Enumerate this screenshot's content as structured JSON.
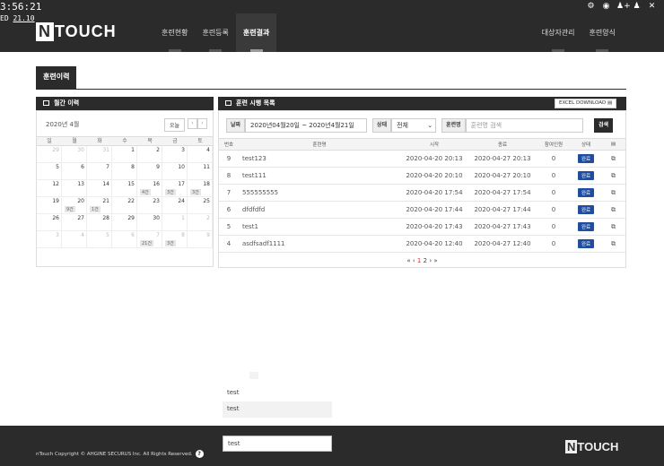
{
  "top": {
    "clock": "3:56:21",
    "clock_sub_a": "ED",
    "clock_sub_b": "21.10",
    "icons": [
      "gear-icon",
      "eye-icon",
      "user-add-icon",
      "user-icon",
      "close-icon"
    ]
  },
  "header": {
    "logo_n": "N",
    "logo_text": "TOUCH",
    "nav": [
      "훈련현황",
      "훈련등록",
      "훈련결과"
    ],
    "nav_active": 2,
    "nav_right": [
      "대상자관리",
      "훈련양식"
    ]
  },
  "page_tab": "훈련이력",
  "calendar": {
    "title": "월간 이력",
    "month": "2020년 4월",
    "today_label": "오늘",
    "prev": "‹",
    "next": "›",
    "dow": [
      "일",
      "월",
      "화",
      "수",
      "목",
      "금",
      "토"
    ],
    "cells": [
      {
        "d": "29",
        "dim": true
      },
      {
        "d": "30",
        "dim": true
      },
      {
        "d": "31",
        "dim": true
      },
      {
        "d": "1"
      },
      {
        "d": "2"
      },
      {
        "d": "3"
      },
      {
        "d": "4"
      },
      {
        "d": "5"
      },
      {
        "d": "6"
      },
      {
        "d": "7"
      },
      {
        "d": "8"
      },
      {
        "d": "9"
      },
      {
        "d": "10"
      },
      {
        "d": "11"
      },
      {
        "d": "12"
      },
      {
        "d": "13"
      },
      {
        "d": "14"
      },
      {
        "d": "15"
      },
      {
        "d": "16",
        "badge": "4건"
      },
      {
        "d": "17",
        "badge": "3건"
      },
      {
        "d": "18",
        "badge": "3건"
      },
      {
        "d": "19"
      },
      {
        "d": "20",
        "badge": "9건"
      },
      {
        "d": "21",
        "badge": "1건"
      },
      {
        "d": "22"
      },
      {
        "d": "23"
      },
      {
        "d": "24"
      },
      {
        "d": "25"
      },
      {
        "d": "26"
      },
      {
        "d": "27"
      },
      {
        "d": "28"
      },
      {
        "d": "29"
      },
      {
        "d": "30"
      },
      {
        "d": "1",
        "dim": true
      },
      {
        "d": "2",
        "dim": true
      },
      {
        "d": "3",
        "dim": true
      },
      {
        "d": "4",
        "dim": true
      },
      {
        "d": "5",
        "dim": true
      },
      {
        "d": "6",
        "dim": true
      },
      {
        "d": "7",
        "dim": true,
        "badge": "21건"
      },
      {
        "d": "8",
        "dim": true,
        "badge": "3건"
      },
      {
        "d": "9",
        "dim": true
      }
    ]
  },
  "history": {
    "title": "훈련 시행 목록",
    "excel_label": "EXCEL DOWNLOAD",
    "filter": {
      "date_label": "날짜",
      "date_range": "2020년04월20일  ~  2020년4월21일",
      "status_label": "상태",
      "status_value": "전체",
      "name_label": "훈련명",
      "name_placeholder": "훈련명 검색",
      "search_label": "검색"
    },
    "columns": [
      "번호",
      "훈련명",
      "시작",
      "종료",
      "참여인원",
      "상태",
      ""
    ],
    "rows": [
      {
        "no": "9",
        "name": "test123",
        "start": "2020-04-20 20:13",
        "end": "2020-04-27 20:13",
        "count": "0",
        "status": "완료"
      },
      {
        "no": "8",
        "name": "test111",
        "start": "2020-04-20 20:10",
        "end": "2020-04-27 20:10",
        "count": "0",
        "status": "완료"
      },
      {
        "no": "7",
        "name": "555555555",
        "start": "2020-04-20 17:54",
        "end": "2020-04-27 17:54",
        "count": "0",
        "status": "완료"
      },
      {
        "no": "6",
        "name": "dfdfdfd",
        "start": "2020-04-20 17:44",
        "end": "2020-04-27 17:44",
        "count": "0",
        "status": "완료"
      },
      {
        "no": "5",
        "name": "test1",
        "start": "2020-04-20 17:43",
        "end": "2020-04-27 17:43",
        "count": "0",
        "status": "완료"
      },
      {
        "no": "4",
        "name": "asdfsadf1111",
        "start": "2020-04-20 12:40",
        "end": "2020-04-27 12:40",
        "count": "0",
        "status": "완료"
      }
    ],
    "pager": {
      "first": "«",
      "prev": "‹",
      "pages": [
        "1",
        "2"
      ],
      "current": "1",
      "next": "›",
      "last": "»"
    }
  },
  "floating": [
    "test",
    "test"
  ],
  "footer": {
    "copyright": "nTouch Copyright © AHGINE SECURUS Inc. All Rights Reserved.",
    "help": "?",
    "input_value": "test",
    "logo_n": "N",
    "logo_text": "TOUCH"
  }
}
